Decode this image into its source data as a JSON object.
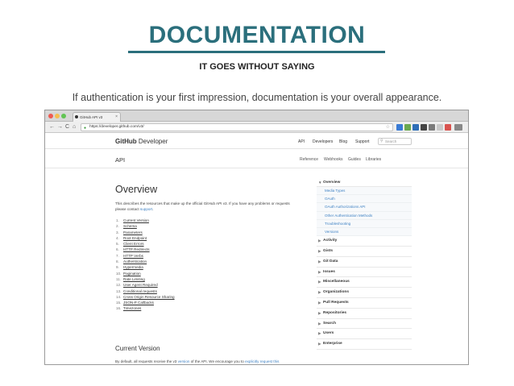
{
  "slide": {
    "title": "DOCUMENTATION",
    "subtitle": "IT GOES WITHOUT SAYING",
    "lead": "If authentication is your first impression, documentation is your overall appearance."
  },
  "browser": {
    "tab_title": "GitHub API v3",
    "tab_close": "×",
    "url": "https://developer.github.com/v3/",
    "lock_icon": "lock-icon",
    "back": "←",
    "forward": "→",
    "reload": "C",
    "home": "⌂",
    "star": "☆",
    "colors": {
      "close": "#ee5a52",
      "minimize": "#f5be4f",
      "zoom": "#61c454"
    }
  },
  "site": {
    "logo_bold": "GitHub",
    "logo_rest": " Developer",
    "nav": [
      "API",
      "Developers",
      "Blog",
      "Support"
    ],
    "search_placeholder": "Search",
    "section": "API",
    "section_tabs": [
      "Reference",
      "Webhooks",
      "Guides",
      "Libraries"
    ]
  },
  "content": {
    "heading": "Overview",
    "intro_text": "This describes the resources that make up the official GitHub API v3. If you have any problems or requests please contact ",
    "intro_link": "support",
    "intro_end": ".",
    "toc": [
      {
        "num": "1.",
        "label": "Current Version"
      },
      {
        "num": "2.",
        "label": "Schema"
      },
      {
        "num": "3.",
        "label": "Parameters"
      },
      {
        "num": "4.",
        "label": "Root Endpoint"
      },
      {
        "num": "5.",
        "label": "Client Errors"
      },
      {
        "num": "6.",
        "label": "HTTP Redirects"
      },
      {
        "num": "7.",
        "label": "HTTP Verbs"
      },
      {
        "num": "8.",
        "label": "Authentication"
      },
      {
        "num": "9.",
        "label": "Hypermedia"
      },
      {
        "num": "10.",
        "label": "Pagination"
      },
      {
        "num": "11.",
        "label": "Rate Limiting"
      },
      {
        "num": "12.",
        "label": "User Agent Required"
      },
      {
        "num": "13.",
        "label": "Conditional requests"
      },
      {
        "num": "14.",
        "label": "Cross Origin Resource Sharing"
      },
      {
        "num": "15.",
        "label": "JSON-P Callbacks"
      },
      {
        "num": "16.",
        "label": "Timezones"
      }
    ],
    "cv_heading": "Current Version",
    "cv_text": "By default, all requests receive the v3 ",
    "cv_link1": "version",
    "cv_mid": " of the API. We encourage you to ",
    "cv_link2": "explicitly request this"
  },
  "sidebar": {
    "open_section": "Overview",
    "sub_items": [
      "Media Types",
      "OAuth",
      "OAuth Authorizations API",
      "Other Authentication Methods",
      "Troubleshooting",
      "Versions"
    ],
    "sections": [
      "Activity",
      "Gists",
      "Git Data",
      "Issues",
      "Miscellaneous",
      "Organizations",
      "Pull Requests",
      "Repositories",
      "Search",
      "Users",
      "Enterprise"
    ]
  }
}
